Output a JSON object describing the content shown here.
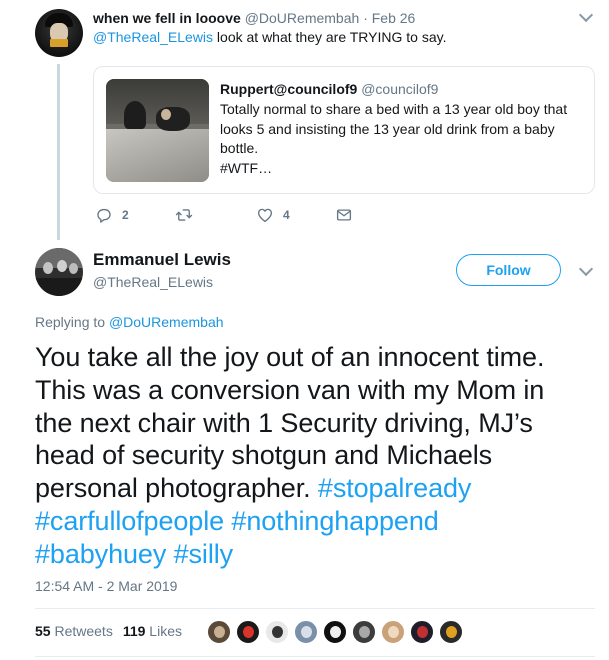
{
  "parent_tweet": {
    "name": "when we fell in looove",
    "handle": "@DoURemembah",
    "separator": "·",
    "date": "Feb 26",
    "mention": "@TheReal_ELewis",
    "text": " look at what they are TRYING to say.",
    "quote": {
      "name": "Ruppert@councilof9",
      "handle": "@councilof9",
      "lines": [
        "Totally normal to share a bed with a 13 year old boy that",
        "looks 5 and insisting the 13 year old drink from a baby",
        "bottle.",
        "#WTF…"
      ]
    },
    "actions": {
      "reply_count": "2",
      "retweet_count": "",
      "like_count": "4"
    }
  },
  "main_tweet": {
    "name": "Emmanuel Lewis",
    "handle": "@TheReal_ELewis",
    "follow_label": "Follow",
    "replying_prefix": "Replying to",
    "replying_to": "@DoURemembah",
    "text_lines": [
      [
        "You take all the joy out of an innocent time.",
        ""
      ],
      [
        "This was a conversion van with my Mom in",
        ""
      ],
      [
        "the next chair with 1 Security driving, MJ’s",
        ""
      ],
      [
        "head of security shotgun and Michaels",
        ""
      ],
      [
        "personal photographer. ",
        "#stopalready"
      ],
      [
        "",
        "#carfullofpeople #nothinghappend"
      ],
      [
        "",
        "#babyhuey #silly"
      ]
    ],
    "timestamp": "12:54 AM - 2 Mar 2019",
    "retweets": {
      "count": "55",
      "label": " Retweets"
    },
    "likes": {
      "count": "119",
      "label": " Likes"
    }
  },
  "colors": {
    "link": "#1b95e0",
    "hashtag": "#1da1f2",
    "secondary_text": "#657786",
    "primary_text": "#14171a",
    "border": "#e1e8ed"
  },
  "icons": {
    "reply": "reply-icon",
    "retweet": "retweet-icon",
    "like": "heart-icon",
    "dm": "envelope-icon",
    "menu": "chevron-down-icon"
  },
  "liker_avatars": [
    {
      "bg": "#5a4a3a",
      "fg": "#c8b090"
    },
    {
      "bg": "#1a1a1a",
      "fg": "#d8342a"
    },
    {
      "bg": "#e8e8e8",
      "fg": "#333333"
    },
    {
      "bg": "#7a8fa8",
      "fg": "#d9dfe8"
    },
    {
      "bg": "#101010",
      "fg": "#f0f0f0"
    },
    {
      "bg": "#3c3c3c",
      "fg": "#a8a8a8"
    },
    {
      "bg": "#c9a27a",
      "fg": "#efd9c0"
    },
    {
      "bg": "#1e1e2a",
      "fg": "#c03030"
    },
    {
      "bg": "#2a2a2a",
      "fg": "#e0a020"
    }
  ]
}
